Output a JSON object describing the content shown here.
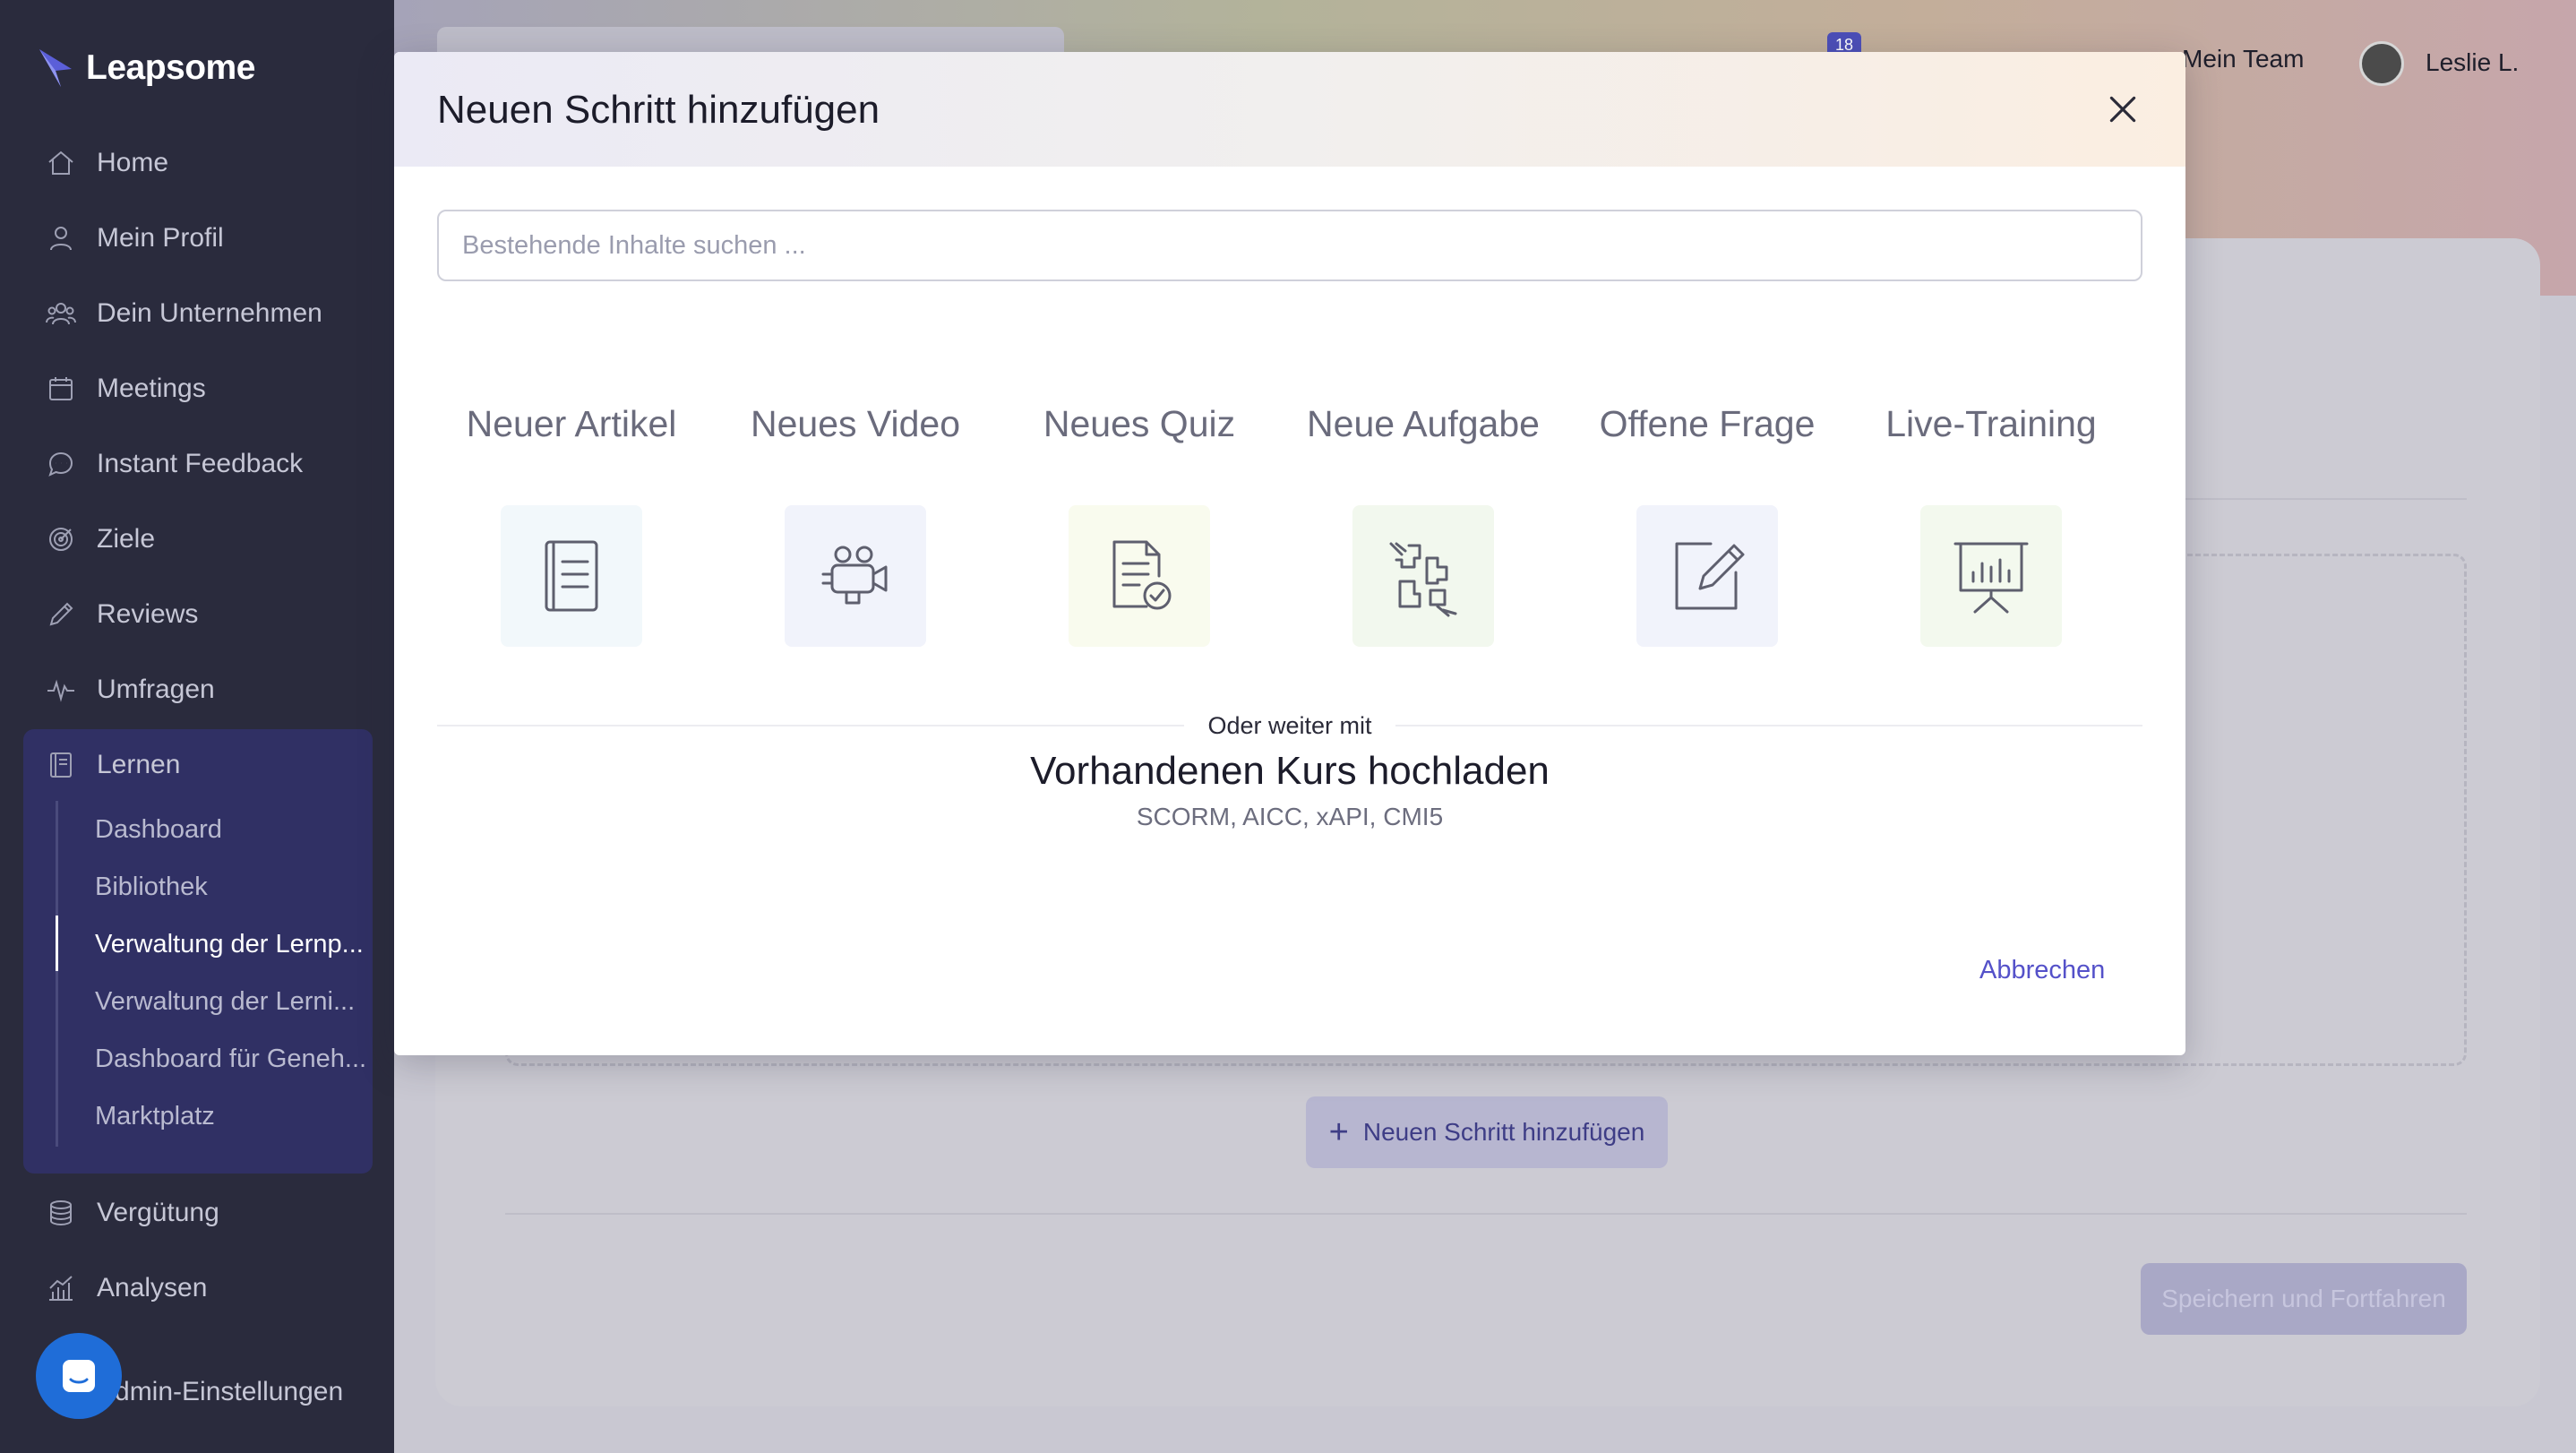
{
  "app": {
    "brand": "Leapsome"
  },
  "sidebar": {
    "items": [
      {
        "label": "Home",
        "icon": "home-icon"
      },
      {
        "label": "Mein Profil",
        "icon": "user-icon"
      },
      {
        "label": "Dein Unternehmen",
        "icon": "users-icon"
      },
      {
        "label": "Meetings",
        "icon": "calendar-icon"
      },
      {
        "label": "Instant Feedback",
        "icon": "chat-icon"
      },
      {
        "label": "Ziele",
        "icon": "target-icon"
      },
      {
        "label": "Reviews",
        "icon": "pencil-icon"
      },
      {
        "label": "Umfragen",
        "icon": "pulse-icon"
      },
      {
        "label": "Lernen",
        "icon": "book-icon"
      },
      {
        "label": "Vergütung",
        "icon": "coins-icon"
      },
      {
        "label": "Analysen",
        "icon": "chart-icon"
      },
      {
        "label": "Admin-Einstellungen",
        "icon": "settings-icon"
      }
    ],
    "learn_sub": [
      {
        "label": "Dashboard"
      },
      {
        "label": "Bibliothek"
      },
      {
        "label": "Verwaltung der Lernp..."
      },
      {
        "label": "Verwaltung der Lerni..."
      },
      {
        "label": "Dashboard für Geneh..."
      },
      {
        "label": "Marktplatz"
      }
    ],
    "active_sub": "Verwaltung der Lernp..."
  },
  "topbar": {
    "notification_count": "18",
    "team_label": "Mein Team",
    "user_name": "Leslie L."
  },
  "background": {
    "add_step_label": "Neuen Schritt hinzufügen",
    "save_label": "Speichern und Fortfahren"
  },
  "modal": {
    "title": "Neuen Schritt hinzufügen",
    "search_placeholder": "Bestehende Inhalte suchen ...",
    "types": [
      {
        "label": "Neuer Artikel",
        "icon": "article-icon",
        "tile_color": "#f2f8fb"
      },
      {
        "label": "Neues Video",
        "icon": "video-camera-icon",
        "tile_color": "#f1f3fb"
      },
      {
        "label": "Neues Quiz",
        "icon": "quiz-icon",
        "tile_color": "#f9fbee"
      },
      {
        "label": "Neue Aufgabe",
        "icon": "puzzle-icon",
        "tile_color": "#f2f8ee"
      },
      {
        "label": "Offene Frage",
        "icon": "edit-icon",
        "tile_color": "#f1f3fb"
      },
      {
        "label": "Live-Training",
        "icon": "presentation-icon",
        "tile_color": "#f3f9ee"
      }
    ],
    "divider_text": "Oder weiter mit",
    "upload_title": "Vorhandenen Kurs hochladen",
    "upload_formats": "SCORM, AICC, xAPI, CMI5",
    "cancel_label": "Abbrechen"
  },
  "colors": {
    "sidebar_bg": "#2a2b3d",
    "accent": "#5451c9",
    "learn_group_bg": "#303064"
  }
}
